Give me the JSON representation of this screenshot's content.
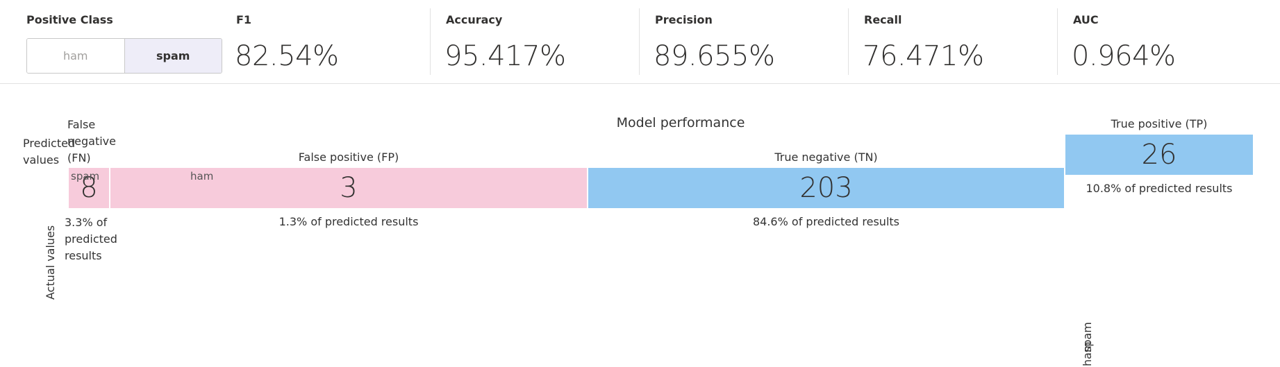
{
  "positive_class": {
    "label": "Positive Class",
    "options": [
      "ham",
      "spam"
    ],
    "selected": "spam"
  },
  "metrics": [
    {
      "label": "F1",
      "value": "82.54%"
    },
    {
      "label": "Accuracy",
      "value": "95.417%"
    },
    {
      "label": "Precision",
      "value": "89.655%"
    },
    {
      "label": "Recall",
      "value": "76.471%"
    },
    {
      "label": "AUC",
      "value": "0.964%"
    }
  ],
  "matrix": {
    "title": "Model performance",
    "predicted_axis_label": "Predicted values",
    "actual_axis_label": "Actual values",
    "column_labels": [
      "spam",
      "ham"
    ],
    "row_labels": [
      "ham",
      "spam"
    ],
    "cells": {
      "fn": {
        "label": "False negative (FN)",
        "value": "8",
        "percent": "3.3% of predicted results"
      },
      "fp": {
        "label": "False positive (FP)",
        "value": "3",
        "percent": "1.3% of predicted results"
      },
      "tn": {
        "label": "True negative (TN)",
        "value": "203",
        "percent": "84.6% of predicted results"
      },
      "tp": {
        "label": "True positive (TP)",
        "value": "26",
        "percent": "10.8% of predicted results"
      }
    },
    "colors": {
      "negative_cell": "#f7cbdb",
      "positive_cell": "#91c8f1"
    }
  }
}
